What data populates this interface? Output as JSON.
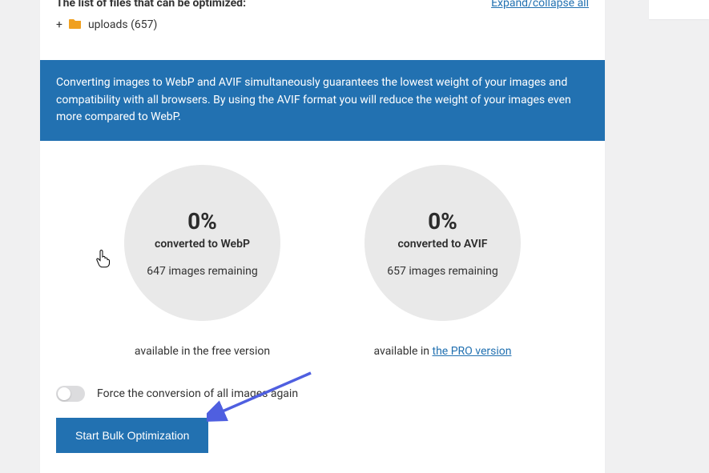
{
  "files": {
    "title": "The list of files that can be optimized:",
    "expand_collapse": "Expand/collapse all",
    "folder_name": "uploads (657)"
  },
  "banner": {
    "text": "Converting images to WebP and AVIF simultaneously guarantees the lowest weight of your images and compatibility with all browsers. By using the AVIF format you will reduce the weight of your images even more compared to WebP."
  },
  "stats": {
    "webp": {
      "percent": "0%",
      "label": "converted to WebP",
      "remaining": "647 images remaining",
      "availability": "available in the free version"
    },
    "avif": {
      "percent": "0%",
      "label": "converted to AVIF",
      "remaining": "657 images remaining",
      "availability_prefix": "available in ",
      "availability_link": "the PRO version"
    }
  },
  "force_toggle": {
    "label": "Force the conversion of all images again"
  },
  "start_button": {
    "label": "Start Bulk Optimization"
  },
  "colors": {
    "primary": "#2271b1",
    "folder": "#f0a020",
    "circle_bg": "#e9e9e9"
  }
}
